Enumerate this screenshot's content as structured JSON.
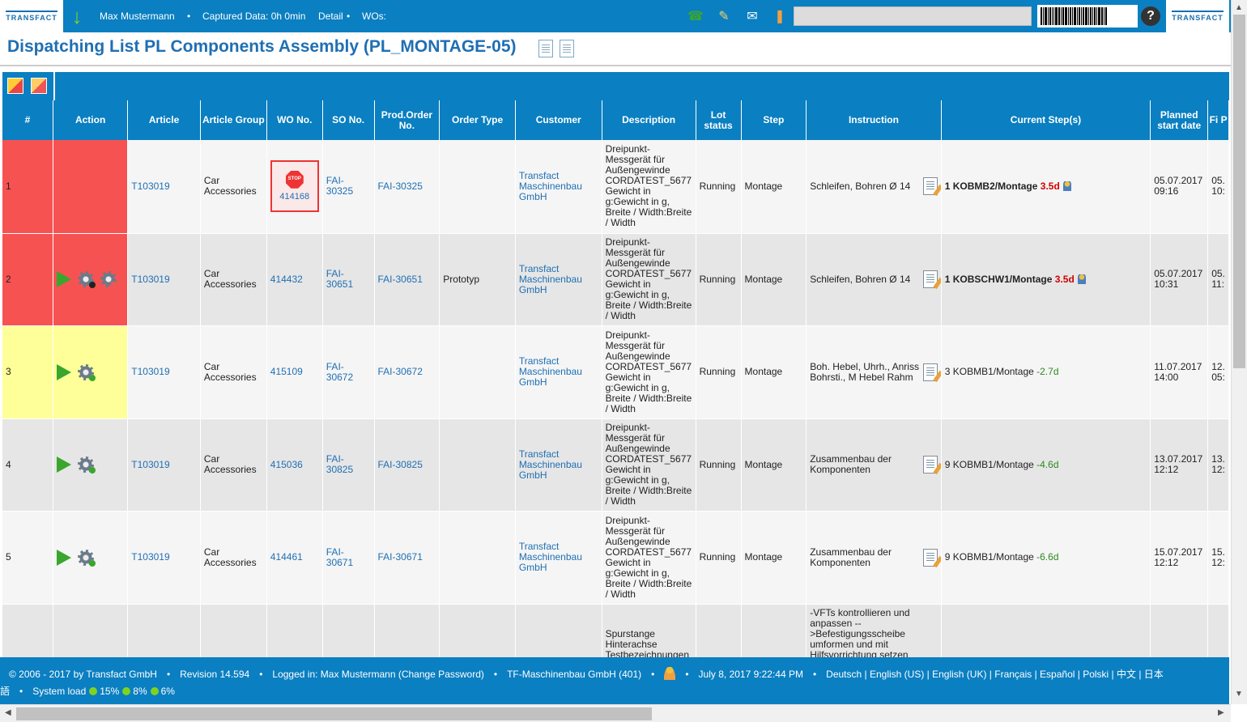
{
  "header": {
    "logo_text": "TRANSFACT",
    "user": "Max Mustermann",
    "captured": "Captured Data: 0h 0min",
    "detail": "Detail",
    "wos": "WOs:",
    "search_placeholder": "",
    "help": "?"
  },
  "page": {
    "title": "Dispatching List PL Components Assembly (PL_MONTAGE-05)"
  },
  "table": {
    "headers": {
      "num": "#",
      "action": "Action",
      "article": "Article",
      "article_group": "Article Group",
      "wo_no": "WO No.",
      "so_no": "SO No.",
      "prod_order": "Prod.Order No.",
      "order_type": "Order Type",
      "customer": "Customer",
      "description": "Description",
      "lot_status": "Lot status",
      "step": "Step",
      "instruction": "Instruction",
      "current_steps": "Current Step(s)",
      "planned_start": "Planned start date",
      "finish": "Fi P"
    },
    "rows": [
      {
        "num": "1",
        "article": "T103019",
        "group": "Car Accessories",
        "wo": "414168",
        "so": "FAI-30325",
        "po": "FAI-30325",
        "order_type": "",
        "customer": "Transfact Maschinenbau GmbH",
        "desc": "Dreipunkt-Messgerät für Außengewinde CORDATEST_5677 Gewicht in g:Gewicht in g, Breite / Width:Breite / Width",
        "lot": "Running",
        "step": "Montage",
        "instr": "Schleifen, Bohren Ø 14",
        "cs_main": "1 KOBMB2/Montage",
        "cs_delta": "3.5d",
        "planned": "05.07.2017 09:16",
        "finish": "05. 10:"
      },
      {
        "num": "2",
        "article": "T103019",
        "group": "Car Accessories",
        "wo": "414432",
        "so": "FAI-30651",
        "po": "FAI-30651",
        "order_type": "Prototyp",
        "customer": "Transfact Maschinenbau GmbH",
        "desc": "Dreipunkt-Messgerät für Außengewinde CORDATEST_5677 Gewicht in g:Gewicht in g, Breite / Width:Breite / Width",
        "lot": "Running",
        "step": "Montage",
        "instr": "Schleifen, Bohren Ø 14",
        "cs_main": "1 KOBSCHW1/Montage",
        "cs_delta": "3.5d",
        "planned": "05.07.2017 10:31",
        "finish": "05. 11:"
      },
      {
        "num": "3",
        "article": "T103019",
        "group": "Car Accessories",
        "wo": "415109",
        "so": "FAI-30672",
        "po": "FAI-30672",
        "order_type": "",
        "customer": "Transfact Maschinenbau GmbH",
        "desc": "Dreipunkt-Messgerät für Außengewinde CORDATEST_5677 Gewicht in g:Gewicht in g, Breite / Width:Breite / Width",
        "lot": "Running",
        "step": "Montage",
        "instr": "Boh. Hebel, Uhrh., Anriss Bohrsti., M Hebel Rahm",
        "cs_main": "3 KOBMB1/Montage",
        "cs_delta": "-2.7d",
        "planned": "11.07.2017 14:00",
        "finish": "12. 05:"
      },
      {
        "num": "4",
        "article": "T103019",
        "group": "Car Accessories",
        "wo": "415036",
        "so": "FAI-30825",
        "po": "FAI-30825",
        "order_type": "",
        "customer": "Transfact Maschinenbau GmbH",
        "desc": "Dreipunkt-Messgerät für Außengewinde CORDATEST_5677 Gewicht in g:Gewicht in g, Breite / Width:Breite / Width",
        "lot": "Running",
        "step": "Montage",
        "instr": "Zusammenbau der Komponenten",
        "cs_main": "9 KOBMB1/Montage",
        "cs_delta": "-4.6d",
        "planned": "13.07.2017 12:12",
        "finish": "13. 12:"
      },
      {
        "num": "5",
        "article": "T103019",
        "group": "Car Accessories",
        "wo": "414461",
        "so": "FAI-30671",
        "po": "FAI-30671",
        "order_type": "",
        "customer": "Transfact Maschinenbau GmbH",
        "desc": "Dreipunkt-Messgerät für Außengewinde CORDATEST_5677 Gewicht in g:Gewicht in g, Breite / Width:Breite / Width",
        "lot": "Running",
        "step": "Montage",
        "instr": "Zusammenbau der Komponenten",
        "cs_main": "9 KOBMB1/Montage",
        "cs_delta": "-6.6d",
        "planned": "15.07.2017 12:12",
        "finish": "15. 12:"
      },
      {
        "num": "",
        "article": "",
        "group": "",
        "wo": "",
        "so": "",
        "po": "",
        "order_type": "",
        "customer": "",
        "desc": "Spurstange Hinterachse Testbezeichnungen",
        "lot": "",
        "step": "",
        "instr": "-VFTs kontrollieren und anpassen -->Befestigungsscheibe umformen und mit Hilfsvorrichtung setzen",
        "cs_main": "",
        "cs_delta": "",
        "planned": "",
        "finish": ""
      }
    ]
  },
  "footer": {
    "copyright": "© 2006 - 2017 by Transfact GmbH",
    "revision": "Revision  14.594",
    "logged_in": "Logged in: Max Mustermann (Change Password)",
    "company": "TF-Maschinenbau GmbH (401)",
    "datetime": "July 8, 2017 9:22:44 PM",
    "languages": "Deutsch | English (US) | English (UK) | Français | Español | Polski | 中文 | 日本",
    "lang_wrap": "語",
    "system_load": "System load",
    "load1": "15%",
    "load2": "8%",
    "load3": "6%"
  }
}
